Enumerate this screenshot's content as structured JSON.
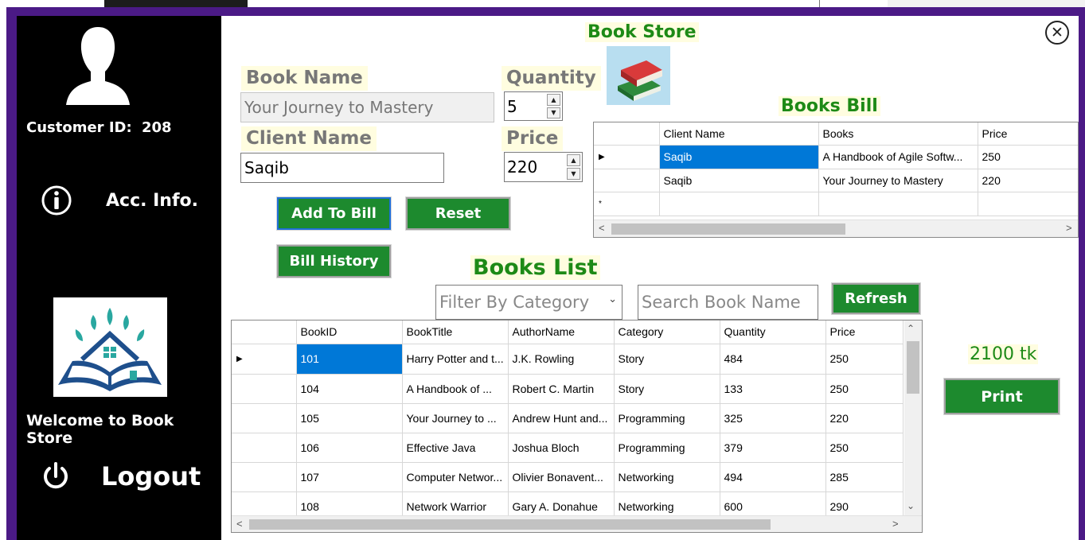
{
  "sidebar": {
    "customer_id_label": "Customer ID:",
    "customer_id": "208",
    "acc_info_label": "Acc. Info.",
    "welcome_text": "Welcome to Book Store",
    "logout_label": "Logout"
  },
  "header": {
    "app_title": "Book Store",
    "close_glyph": "✕"
  },
  "form": {
    "book_name_label": "Book Name",
    "book_name_value": "Your Journey to Mastery",
    "quantity_label": "Quantity",
    "quantity_value": "5",
    "client_name_label": "Client Name",
    "client_name_value": "Saqib",
    "price_label": "Price",
    "price_value": "220",
    "add_to_bill_label": "Add To Bill",
    "reset_label": "Reset",
    "bill_history_label": "Bill History"
  },
  "bill": {
    "title": "Books Bill",
    "columns": [
      "Client Name",
      "Books",
      "Price"
    ],
    "rows": [
      [
        "Saqib",
        "A Handbook of Agile Softw...",
        "250"
      ],
      [
        "Saqib",
        "Your Journey to Mastery",
        "220"
      ]
    ],
    "new_row_marker": "*",
    "current_row_marker": "▶"
  },
  "books": {
    "title": "Books List",
    "filter_placeholder": "Filter By Category",
    "search_placeholder": "Search Book Name",
    "refresh_label": "Refresh",
    "columns": [
      "BookID",
      "BookTitle",
      "AuthorName",
      "Category",
      "Quantity",
      "Price"
    ],
    "rows": [
      [
        "101",
        "Harry Potter and t...",
        "J.K. Rowling",
        "Story",
        "484",
        "250"
      ],
      [
        "104",
        " A Handbook of ...",
        "Robert C. Martin",
        "Story",
        "133",
        "250"
      ],
      [
        "105",
        "Your Journey to ...",
        "Andrew Hunt and...",
        "Programming",
        "325",
        "220"
      ],
      [
        "106",
        "Effective Java",
        "Joshua Bloch",
        "Programming",
        "379",
        "250"
      ],
      [
        "107",
        "Computer Networ...",
        "Olivier Bonavent...",
        "Networking",
        "494",
        "285"
      ],
      [
        "108",
        "Network Warrior",
        "Gary A. Donahue",
        "Networking",
        "600",
        "290"
      ]
    ],
    "current_row_marker": "▶"
  },
  "summary": {
    "total_text": "2100 tk",
    "print_label": "Print"
  },
  "colors": {
    "accent_green": "#1d8a2e",
    "frame_purple": "#4b1a86",
    "label_bg": "#fffde0",
    "selection_blue": "#0078d7"
  }
}
